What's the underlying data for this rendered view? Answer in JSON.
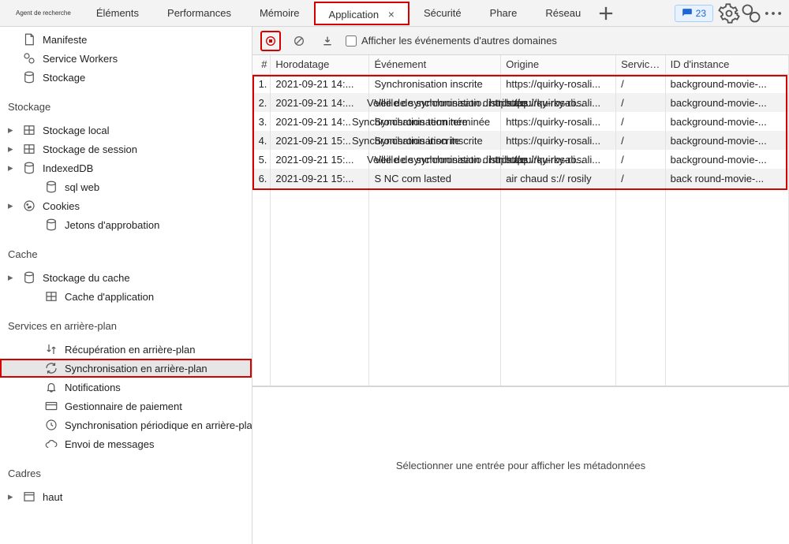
{
  "tabs": {
    "tiny": "Agent de recherche",
    "items": [
      "Éléments",
      "Performances",
      "Mémoire",
      "Application",
      "Sécurité",
      "Phare",
      "Réseau"
    ],
    "active": "Application",
    "count": "23"
  },
  "sidebar": {
    "manifest": "Manifeste",
    "sw": "Service Workers",
    "storage_root": "Stockage",
    "storage_header": "Stockage",
    "storage": {
      "local": "Stockage local",
      "session": "Stockage de session",
      "idb": "IndexedDB",
      "sqlw": "sql web",
      "cookies": "Cookies",
      "tokens": "Jetons d'approbation"
    },
    "cache_header": "Cache",
    "cache": {
      "storage": "Stockage du cache",
      "appcache": "Cache d'application"
    },
    "bg_header": "Services en arrière-plan",
    "bg": {
      "fetch": "Récupération en arrière-plan",
      "sync": "Synchronisation en arrière-plan",
      "notif": "Notifications",
      "pay": "Gestionnaire de paiement",
      "psync": "Synchronisation périodique en arrière-plan",
      "push": "Envoi de messages"
    },
    "frames_header": "Cadres",
    "frames_top": "haut"
  },
  "toolbar": {
    "show_other": "Afficher les événements d'autres domaines"
  },
  "table": {
    "headers": {
      "num": "#",
      "ts": "Horodatage",
      "ev": "Événement",
      "or": "Origine",
      "sw": "Service. ..",
      "id": "ID d'instance"
    },
    "rows": [
      {
        "n": "1.",
        "ts": "2021-09-21 14:...",
        "ev": "Synchronisation inscrite",
        "or": "https://quirky-rosali...",
        "sw": "/",
        "id": "background-movie-..."
      },
      {
        "n": "2.",
        "ts": "2021-09-21 14:...",
        "ev": "Veille de synchronisation distribuée",
        "or": "https://quirky-rosali...",
        "sw": "/",
        "id": "background-movie-..."
      },
      {
        "n": "3.",
        "ts": "2021-09-21 14:..",
        "ev": "Synchronisation terminée",
        "or": "https://quirky-rosali...",
        "sw": "/",
        "id": "background-movie-..."
      },
      {
        "n": "4.",
        "ts": "2021-09-21 15:..",
        "ev": "Synchronisation inscrite",
        "or": "https://quirky-rosali...",
        "sw": "/",
        "id": "background-movie-..."
      },
      {
        "n": "5.",
        "ts": "2021-09-21 15:...",
        "ev": "Veille de synchronisation distribuée",
        "or": "https://quirky-rosali...",
        "sw": "/",
        "id": "background-movie-..."
      },
      {
        "n": "6.",
        "ts": "2021-09-21 15:...",
        "ev": "S NC com lasted",
        "or": "air chaud s:// rosily",
        "sw": "/",
        "id": "back round-movie-..."
      }
    ]
  },
  "detail": {
    "placeholder": "Sélectionner une entrée pour afficher les métadonnées"
  }
}
